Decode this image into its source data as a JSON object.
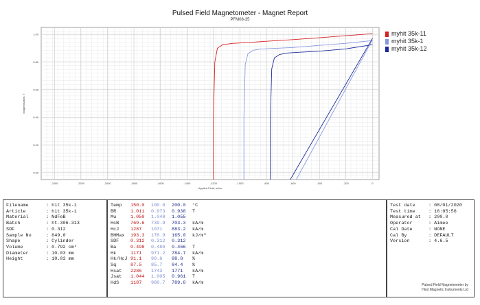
{
  "report": {
    "title": "Pulsed Field Magnetometer - Magnet Report",
    "subtitle": "PFM08-35"
  },
  "chart_data": {
    "type": "line",
    "title": "",
    "xlabel": "Applied Field, kA/m",
    "ylabel": "Magnetisation, T",
    "xlim": [
      -2500,
      50
    ],
    "ylim": [
      -0.05,
      1.05
    ],
    "x_ticks": [
      "-2400",
      "-2200",
      "-2000",
      "-1800",
      "-1600",
      "-1400",
      "-1200",
      "-1000",
      "-800",
      "-600",
      "-400",
      "-200",
      "0"
    ],
    "y_ticks": [
      "0.00",
      "0.20",
      "0.40",
      "0.60",
      "0.80",
      "1.00"
    ],
    "grid": true,
    "legend_position": "right",
    "series": [
      {
        "name": "myhit 35k-11",
        "color": "#d62020",
        "x": [
          -1200,
          -1200,
          -1190,
          -1170,
          -1130,
          -1050,
          -950,
          -800,
          -600,
          -400,
          -200,
          0
        ],
        "y": [
          -0.05,
          0.4,
          0.8,
          0.9,
          0.925,
          0.935,
          0.94,
          0.95,
          0.962,
          0.975,
          0.99,
          1.005
        ]
      },
      {
        "name": "myhit 35k-1",
        "color": "#8898e0",
        "x": [
          -970,
          -970,
          -960,
          -940,
          -900,
          -850,
          -780,
          -600,
          -400,
          -200,
          0
        ],
        "y": [
          -0.05,
          0.4,
          0.78,
          0.86,
          0.885,
          0.893,
          0.897,
          0.905,
          0.92,
          0.935,
          0.955
        ]
      },
      {
        "name": "myhit 35k-12",
        "color": "#1a2a9a",
        "x": [
          -770,
          -770,
          -760,
          -740,
          -700,
          -640,
          -560,
          -400,
          -200,
          0
        ],
        "y": [
          -0.05,
          0.4,
          0.75,
          0.83,
          0.855,
          0.865,
          0.87,
          0.878,
          0.895,
          0.925
        ]
      },
      {
        "name": "",
        "color": "#1a2a9a",
        "x": [
          -620,
          0
        ],
        "y": [
          -0.05,
          0.97
        ]
      },
      {
        "name": "",
        "color": "#8898e0",
        "x": [
          -575,
          0
        ],
        "y": [
          -0.05,
          0.96
        ]
      }
    ]
  },
  "sample_info": [
    {
      "key": "Filename",
      "value": ": hit 35k-1"
    },
    {
      "key": "Article",
      "value": ": hit 35k-1"
    },
    {
      "key": "Material",
      "value": ": NdFeB"
    },
    {
      "key": "Batch",
      "value": ": ht-306-313"
    },
    {
      "key": "SDF",
      "value": ": 0.312"
    },
    {
      "key": "Sample No",
      "value": ": 649.0"
    },
    {
      "key": "Shape",
      "value": ": Cylinder"
    },
    {
      "key": "Volume",
      "value": ": 0.792 cm³"
    },
    {
      "key": "Diameter",
      "value": ": 10.03 mm"
    },
    {
      "key": "Height",
      "value": ": 10.03 mm"
    }
  ],
  "measurements": [
    {
      "key": "Temp",
      "v1": "150.0",
      "v2": "100.0",
      "v3": "200.0",
      "unit": "°C"
    },
    {
      "key": "BR",
      "v1": "1.011",
      "v2": "0.973",
      "v3": "0.938",
      "unit": "T"
    },
    {
      "key": "Mu",
      "v1": "1.050",
      "v2": "1.048",
      "v3": "1.055",
      "unit": ""
    },
    {
      "key": "HcB",
      "v1": "769.6",
      "v2": "739.9",
      "v3": "703.3",
      "unit": "kA/m"
    },
    {
      "key": "HcJ",
      "v1": "1287",
      "v2": "1071",
      "v3": "883.2",
      "unit": "kA/m"
    },
    {
      "key": "BHMax",
      "v1": "193.3",
      "v2": "176.9",
      "v3": "165.0",
      "unit": "kJ/m³"
    },
    {
      "key": "SDF",
      "v1": "0.312",
      "v2": "0.312",
      "v3": "0.312",
      "unit": ""
    },
    {
      "key": "Ba",
      "v1": "0.498",
      "v2": "0.480",
      "v3": "0.466",
      "unit": "T"
    },
    {
      "key": "Hk",
      "v1": "1171",
      "v2": "971.2",
      "v3": "784.7",
      "unit": "kA/m"
    },
    {
      "key": "Hk/HcJ",
      "v1": "91.1",
      "v2": "90.6",
      "v3": "88.8",
      "unit": "%"
    },
    {
      "key": "Sq",
      "v1": "87.5",
      "v2": "85.7",
      "v3": "84.4",
      "unit": "%"
    },
    {
      "key": "Hsat",
      "v1": "2286",
      "v2": "1743",
      "v3": "1771",
      "unit": "kA/m"
    },
    {
      "key": "Jsat",
      "v1": "1.044",
      "v2": "1.005",
      "v3": "0.961",
      "unit": "T"
    },
    {
      "key": "HdS",
      "v1": "1187",
      "v2": "980.7",
      "v3": "789.8",
      "unit": "kA/m"
    }
  ],
  "test_info": [
    {
      "key": "Test date",
      "value": ": 08/01/2020"
    },
    {
      "key": "Test time",
      "value": ": 16:05:56"
    },
    {
      "key": "Measured at",
      "value": ": 200.0"
    },
    {
      "key": "Operator",
      "value": ": Aimee"
    },
    {
      "key": "Cal Date",
      "value": ": NONE"
    },
    {
      "key": "Cal By",
      "value": ": DEFAULT"
    },
    {
      "key": "Version",
      "value": ": 4.6.5"
    }
  ],
  "footer": {
    "line1": "Pulsed Field Magnetometer by",
    "line2": "Hirst Magnetic Instruments Ltd"
  }
}
